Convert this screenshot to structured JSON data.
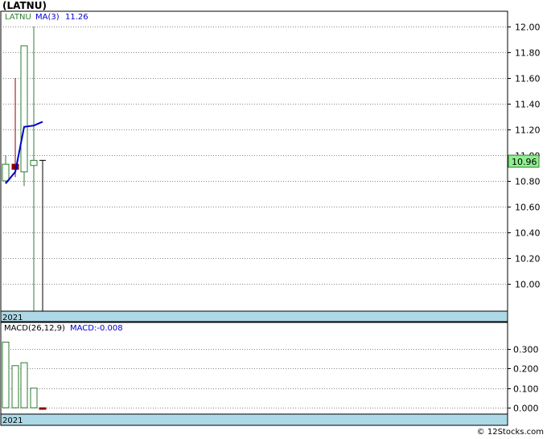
{
  "title": "(LATNU)",
  "footer": "© 12Stocks.com",
  "price_panel": {
    "symbol": "LATNU",
    "ma_label": "MA(3)",
    "ma_value": "11.26",
    "year_label": "2021",
    "last_price_label": "10.96"
  },
  "macd_panel": {
    "label": "MACD(26,12,9)",
    "value_label": "MACD:-0.008",
    "year_label": "2021"
  },
  "colors": {
    "up": "#2e7d32",
    "down": "#8b0000",
    "ma": "#0000cc",
    "band": "#add8e6",
    "price_box": "#90ee90"
  },
  "chart_data": [
    {
      "type": "candlestick",
      "series": "LATNU",
      "ylim": [
        9.8,
        12.1
      ],
      "y_ticks": [
        10.0,
        10.2,
        10.4,
        10.6,
        10.8,
        11.0,
        11.2,
        11.4,
        11.6,
        11.8,
        12.0
      ],
      "y_tick_labels": [
        "10.00",
        "10.20",
        "10.40",
        "10.60",
        "10.80",
        "11.00",
        "11.20",
        "11.40",
        "11.60",
        "11.80",
        "12.00"
      ],
      "candles": [
        {
          "open": 10.8,
          "high": 11.0,
          "low": 10.78,
          "close": 10.93,
          "dir": "up"
        },
        {
          "open": 10.93,
          "high": 11.6,
          "low": 10.83,
          "close": 10.89,
          "dir": "down"
        },
        {
          "open": 10.87,
          "high": 11.85,
          "low": 10.76,
          "close": 11.85,
          "dir": "up"
        },
        {
          "open": 10.92,
          "high": 12.0,
          "low": 9.78,
          "close": 10.96,
          "dir": "up"
        },
        {
          "open": 10.96,
          "high": 10.96,
          "low": 9.78,
          "close": 10.96,
          "dir": "flat"
        }
      ],
      "ma": [
        10.78,
        10.87,
        11.22,
        11.23,
        11.26
      ],
      "last_price": 10.96
    },
    {
      "type": "bar",
      "series": "MACD(26,12,9)",
      "ylim": [
        -0.02,
        0.37
      ],
      "y_ticks": [
        0.0,
        0.1,
        0.2,
        0.3
      ],
      "y_tick_labels": [
        "0.000",
        "0.100",
        "0.200",
        "0.300"
      ],
      "values": [
        0.335,
        0.215,
        0.23,
        0.1,
        -0.008
      ]
    }
  ]
}
